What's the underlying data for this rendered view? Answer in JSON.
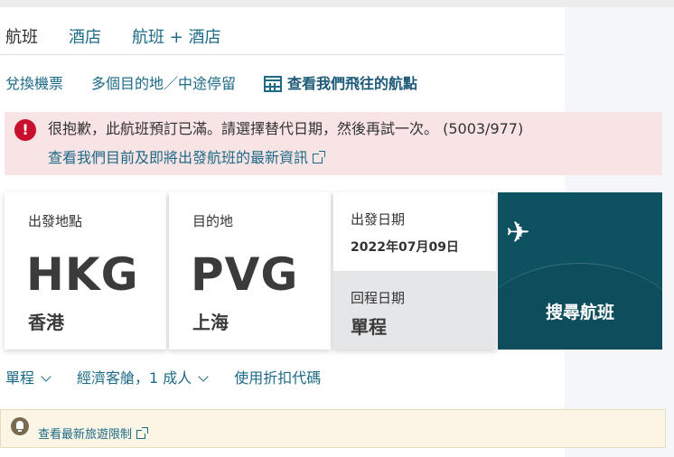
{
  "tabs": [
    {
      "label": "航班"
    },
    {
      "label": "酒店"
    },
    {
      "label": "航班 + 酒店"
    }
  ],
  "links": {
    "redeem": "兌換機票",
    "multi_city": "多個目的地／中途停留",
    "destinations": "查看我們飛往的航點"
  },
  "error": {
    "icon": "!",
    "message": "很抱歉，此航班預訂已滿。請選擇替代日期，然後再試一次。 (5003/977)",
    "link": "查看我們目前及即將出發航班的最新資訊"
  },
  "origin": {
    "label": "出發地點",
    "code": "HKG",
    "city": "香港"
  },
  "destination": {
    "label": "目的地",
    "code": "PVG",
    "city": "上海"
  },
  "departure": {
    "label": "出發日期",
    "date": "2022年07月09日"
  },
  "return": {
    "label": "回程日期",
    "value": "單程"
  },
  "search": {
    "label": "搜尋航班",
    "icon": "✈"
  },
  "options": {
    "trip_type": "單程",
    "cabin_passengers": "經濟客艙，1 成人",
    "promo": "使用折扣代碼"
  },
  "notice": {
    "link": "查看最新旅遊限制"
  },
  "colors": {
    "accent": "#1d6a86",
    "search_button": "#0e5261",
    "error_bg": "#f8e3e5",
    "error_icon": "#c8102e",
    "notice_bg": "#fbf5e6"
  }
}
